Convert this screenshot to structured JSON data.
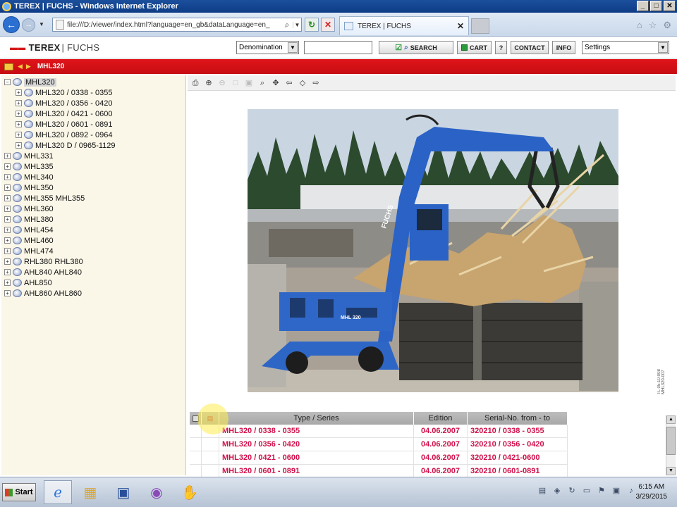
{
  "window": {
    "title": "TEREX | FUCHS - Windows Internet Explorer",
    "buttons": [
      "_",
      "□",
      "✕"
    ]
  },
  "browser": {
    "url": "file:///D:/viewer/index.html?language=en_gb&dataLanguage=en_",
    "tab_label": "TEREX | FUCHS",
    "tab_close": "✕"
  },
  "header": {
    "logo_mark": "▬▬",
    "logo_a": "TEREX",
    "logo_b": "| FUCHS",
    "search_mode": "Denomination",
    "search_value": "",
    "search_button": "SEARCH",
    "cart_button": "CART",
    "help_button": "?",
    "contact_button": "CONTACT",
    "info_button": "INFO",
    "settings_select": "Settings"
  },
  "breadcrumb": {
    "current": "MHL320"
  },
  "tree": {
    "root": "MHL320",
    "children": [
      "MHL320 / 0338 - 0355",
      "MHL320 / 0356 - 0420",
      "MHL320 / 0421 - 0600",
      "MHL320 / 0601 - 0891",
      "MHL320 / 0892 - 0964",
      "MHL320 D / 0965-1129"
    ],
    "siblings": [
      "MHL331",
      "MHL335",
      "MHL340",
      "MHL350",
      "MHL355 MHL355",
      "MHL360",
      "MHL380",
      "MHL454",
      "MHL460",
      "MHL474",
      "RHL380 RHL380",
      "AHL840 AHL840",
      "AHL850",
      "AHL860 AHL860"
    ]
  },
  "photo": {
    "machine_brand": "FUCHS",
    "machine_model": "MHL 320",
    "side_label": "TL 05-10-008 MHL320-007"
  },
  "table": {
    "headers": [
      "Type / Series",
      "Edition",
      "Serial-No. from - to"
    ],
    "rows": [
      {
        "type": "MHL320 / 0338 - 0355",
        "edition": "04.06.2007",
        "serial": "320210 / 0338 - 0355"
      },
      {
        "type": "MHL320 / 0356 - 0420",
        "edition": "04.06.2007",
        "serial": "320210 / 0356 - 0420"
      },
      {
        "type": "MHL320 / 0421 - 0600",
        "edition": "04.06.2007",
        "serial": "320210 / 0421-0600"
      },
      {
        "type": "MHL320 / 0601 - 0891",
        "edition": "04.06.2007",
        "serial": "320210 / 0601-0891"
      }
    ]
  },
  "taskbar": {
    "start_label": "Start",
    "time": "6:15 AM",
    "date": "3/29/2015"
  },
  "colors": {
    "accent_red": "#d0104a",
    "brand_red": "#d41a1a",
    "ie_blue": "#1b4f9c"
  }
}
